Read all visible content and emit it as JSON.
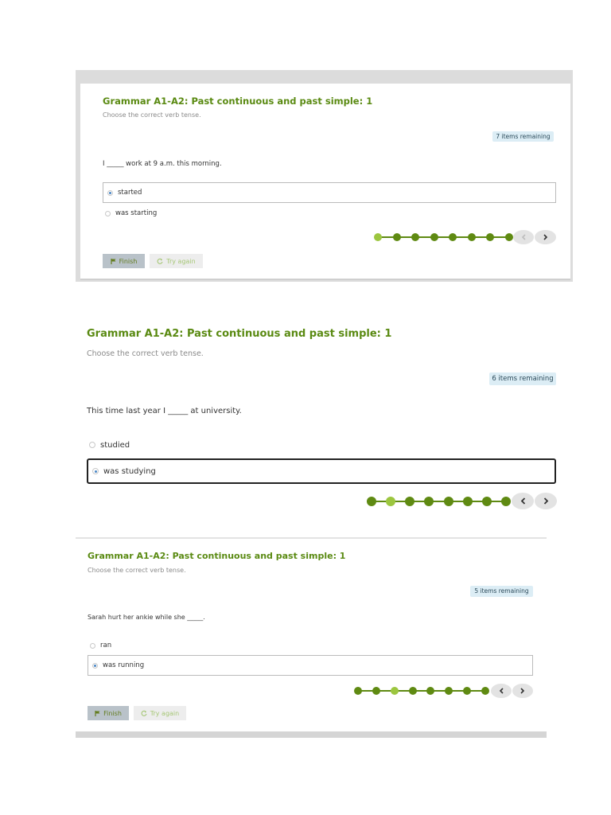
{
  "quizzes": [
    {
      "title": "Grammar A1-A2: Past continuous and past simple: 1",
      "instruction": "Choose the correct verb tense.",
      "remaining": "7 items remaining",
      "question": "I _____ work at 9 a.m. this morning.",
      "options": [
        {
          "label": "started",
          "selected": true
        },
        {
          "label": "was starting",
          "selected": false
        }
      ],
      "progress": {
        "total": 8,
        "current": 1
      },
      "finish_label": "Finish",
      "try_again_label": "Try again"
    },
    {
      "title": "Grammar A1-A2: Past continuous and past simple: 1",
      "instruction": "Choose the correct verb tense.",
      "remaining": "6 items remaining",
      "question": "This time last year I _____ at university.",
      "options": [
        {
          "label": "studied",
          "selected": false
        },
        {
          "label": "was studying",
          "selected": true
        }
      ],
      "progress": {
        "total": 8,
        "current": 2
      }
    },
    {
      "title": "Grammar A1-A2: Past continuous and past simple: 1",
      "instruction": "Choose the correct verb tense.",
      "remaining": "5 items remaining",
      "question": "Sarah hurt her ankie while she _____.",
      "options": [
        {
          "label": "ran",
          "selected": false
        },
        {
          "label": "was running",
          "selected": true
        }
      ],
      "progress": {
        "total": 8,
        "current": 3
      },
      "finish_label": "Finish",
      "try_again_label": "Try again"
    }
  ],
  "icons": {
    "prev": "chevron-left-icon",
    "next": "chevron-right-icon",
    "finish": "flag-icon",
    "try_again": "refresh-icon"
  },
  "colors": {
    "accent": "#5a8a12",
    "current_step": "#9cc63f",
    "badge_bg": "#dcedf5"
  }
}
